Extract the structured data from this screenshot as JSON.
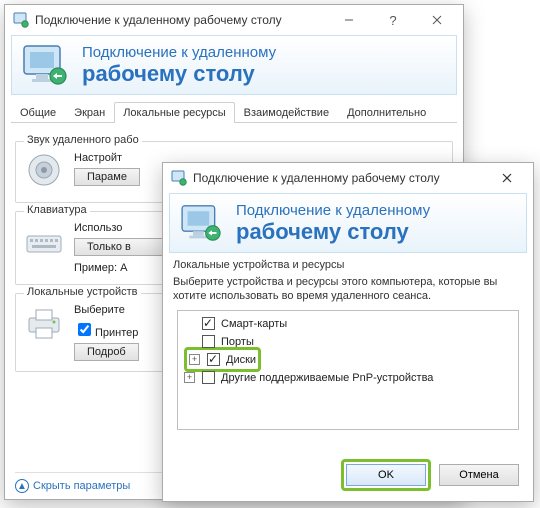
{
  "parent": {
    "title": "Подключение к удаленному рабочему столу",
    "banner_line1": "Подключение к удаленному",
    "banner_line2": "рабочему столу",
    "tabs": {
      "general": "Общие",
      "screen": "Экран",
      "local": "Локальные ресурсы",
      "interaction": "Взаимодействие",
      "advanced": "Дополнительно"
    },
    "sound": {
      "legend": "Звук удаленного рабо",
      "line": "Настройт",
      "button": "Параме"
    },
    "keyboard": {
      "legend": "Клавиатура",
      "line1": "Использо",
      "button": "Только в",
      "line2": "Пример: A"
    },
    "devices": {
      "legend": "Локальные устройств",
      "line": "Выберите",
      "checkbox": "Принтер",
      "button": "Подроб"
    },
    "collapse": "Скрыть параметры"
  },
  "dialog": {
    "title": "Подключение к удаленному рабочему столу",
    "banner_line1": "Подключение к удаленному",
    "banner_line2": "рабочему столу",
    "group_legend": "Локальные устройства и ресурсы",
    "group_desc": "Выберите устройства и ресурсы этого компьютера, которые вы хотите использовать во время удаленного сеанса.",
    "tree": {
      "smartcards": {
        "label": "Смарт-карты",
        "checked": true
      },
      "ports": {
        "label": "Порты",
        "checked": false
      },
      "drives": {
        "label": "Диски",
        "checked": true
      },
      "pnp": {
        "label": "Другие поддерживаемые PnP-устройства",
        "checked": false
      }
    },
    "ok": "OK",
    "cancel": "Отмена"
  }
}
